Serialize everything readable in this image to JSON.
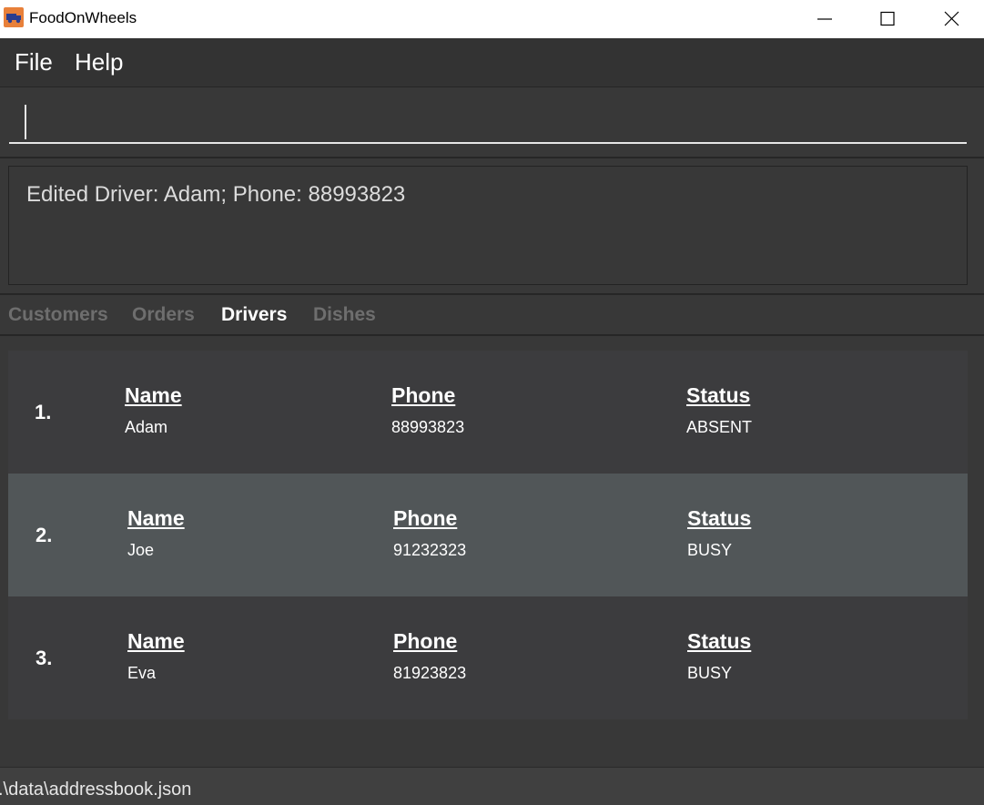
{
  "window": {
    "title": "FoodOnWheels",
    "icon": "truck-icon",
    "controls": [
      "minimize-icon",
      "maximize-icon",
      "close-icon"
    ]
  },
  "menu": {
    "file": "File",
    "help": "Help"
  },
  "command": {
    "value": ""
  },
  "result": {
    "message": "Edited Driver: Adam; Phone: 88993823"
  },
  "tabs": [
    {
      "label": "Customers",
      "active": false
    },
    {
      "label": "Orders",
      "active": false
    },
    {
      "label": "Drivers",
      "active": true
    },
    {
      "label": "Dishes",
      "active": false
    }
  ],
  "drivers": {
    "name_label": "Name",
    "phone_label": "Phone",
    "status_label": "Status",
    "rows": [
      {
        "index": "1.",
        "name": "Adam",
        "phone": "88993823",
        "status": "ABSENT",
        "selected": false
      },
      {
        "index": "2.",
        "name": "Joe",
        "phone": "91232323",
        "status": "BUSY",
        "selected": true
      },
      {
        "index": "3.",
        "name": "Eva",
        "phone": "81923823",
        "status": "BUSY",
        "selected": false
      }
    ]
  },
  "status_bar": {
    "path": ".\\data\\addressbook.json"
  },
  "colors": {
    "background": "#383838",
    "selected_row": "#515658",
    "row": "#3c3c3e",
    "app_icon": "#e8803a"
  }
}
